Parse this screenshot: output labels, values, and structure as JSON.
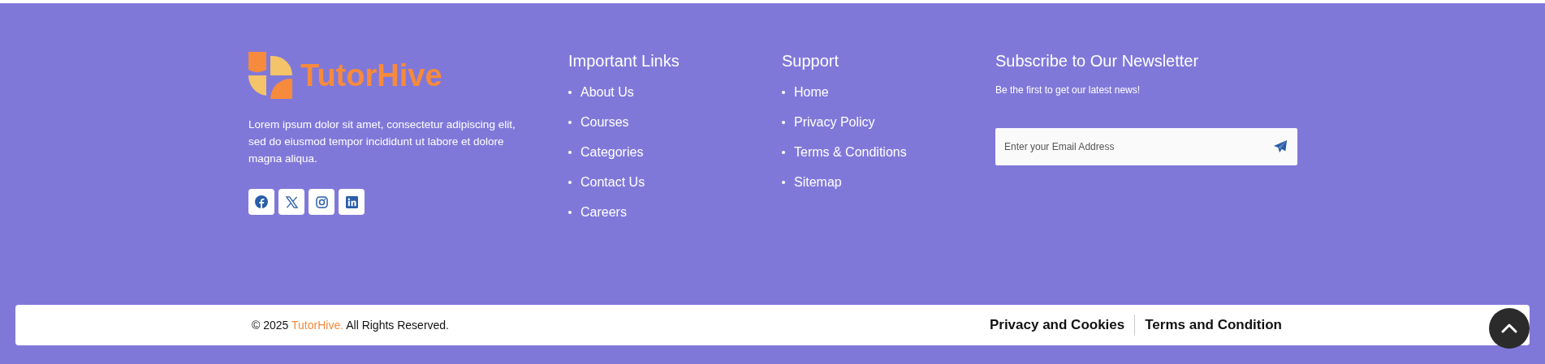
{
  "brand": {
    "name": "TutorHive",
    "description": "Lorem ipsum dolor sit amet, consectetur adipiscing elit, sed do eiusmod tempor incididunt ut labore et dolore magna aliqua.",
    "social": [
      {
        "kind": "facebook"
      },
      {
        "kind": "x"
      },
      {
        "kind": "instagram"
      },
      {
        "kind": "linkedin"
      }
    ]
  },
  "columns": [
    {
      "title": "Important Links",
      "links": [
        "About Us",
        "Courses",
        "Categories",
        "Contact Us",
        "Careers"
      ]
    },
    {
      "title": "Support",
      "links": [
        "Home",
        "Privacy Policy",
        "Terms & Conditions",
        "Sitemap"
      ]
    }
  ],
  "newsletter": {
    "title": "Subscribe to Our Newsletter",
    "subtitle": "Be the first to get our latest news!",
    "placeholder": "Enter your Email Address"
  },
  "bottom_bar": {
    "copyright_prefix": "© 2025",
    "brand": "TutorHive.",
    "copyright_suffix": "All Rights Reserved.",
    "links": [
      "Privacy and Cookies",
      "Terms and Condition"
    ]
  }
}
